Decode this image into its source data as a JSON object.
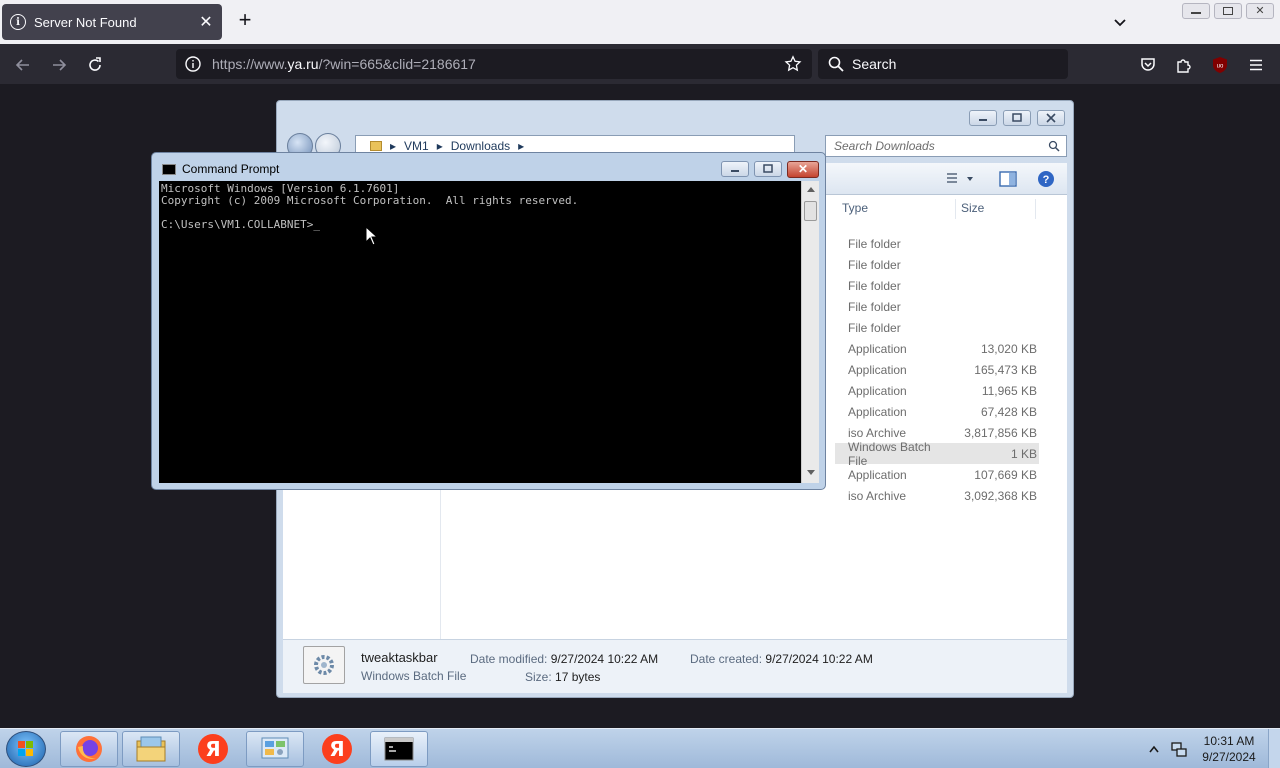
{
  "browser": {
    "tab_title": "Server Not Found",
    "url_prefix": "https://www.",
    "url_host": "ya.ru",
    "url_path": "/?win=665&clid=2186617",
    "search_label": "Search"
  },
  "explorer": {
    "breadcrumb": [
      "VM1",
      "Downloads"
    ],
    "search_placeholder": "Search Downloads",
    "columns": {
      "type": "Type",
      "size": "Size"
    },
    "rows": [
      {
        "type": "File folder",
        "size": ""
      },
      {
        "type": "File folder",
        "size": ""
      },
      {
        "type": "File folder",
        "size": ""
      },
      {
        "type": "File folder",
        "size": ""
      },
      {
        "type": "File folder",
        "size": ""
      },
      {
        "type": "Application",
        "size": "13,020 KB"
      },
      {
        "type": "Application",
        "size": "165,473 KB"
      },
      {
        "type": "Application",
        "size": "11,965 KB"
      },
      {
        "type": "Application",
        "size": "67,428 KB"
      },
      {
        "type": "iso Archive",
        "size": "3,817,856 KB"
      },
      {
        "type": "Windows Batch File",
        "size": "1 KB"
      },
      {
        "type": "Application",
        "size": "107,669 KB"
      },
      {
        "type": "iso Archive",
        "size": "3,092,368 KB"
      }
    ],
    "details": {
      "file_name": "tweaktaskbar",
      "file_type": "Windows Batch File",
      "modified_label": "Date modified:",
      "modified_value": "9/27/2024 10:22 AM",
      "created_label": "Date created:",
      "created_value": "9/27/2024 10:22 AM",
      "size_label": "Size:",
      "size_value": "17 bytes"
    }
  },
  "cmd": {
    "title": "Command Prompt",
    "line1": "Microsoft Windows [Version 6.1.7601]",
    "line2": "Copyright (c) 2009 Microsoft Corporation.  All rights reserved.",
    "prompt": "C:\\Users\\VM1.COLLABNET>_"
  },
  "taskbar": {
    "yandex_glyph": "Я",
    "time": "10:31 AM",
    "date": "9/27/2024"
  }
}
